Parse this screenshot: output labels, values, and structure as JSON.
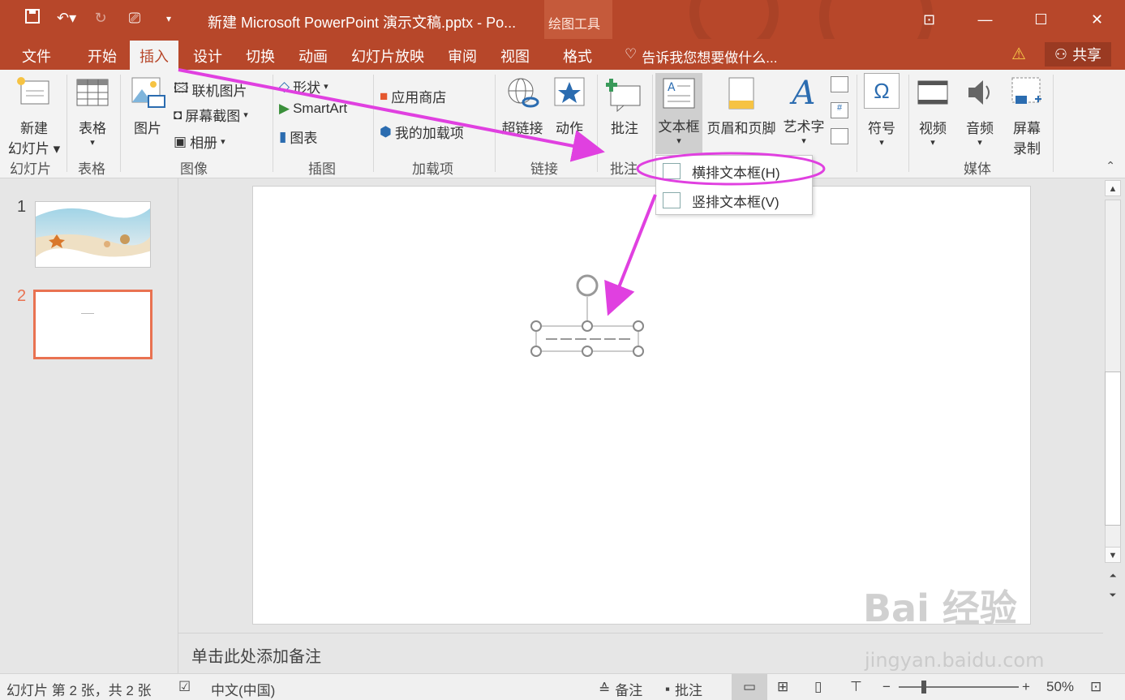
{
  "titlebar": {
    "title": "新建 Microsoft PowerPoint 演示文稿.pptx - Po...",
    "context_tab": "绘图工具",
    "accent": "#b7472a"
  },
  "tabs": [
    "文件",
    "开始",
    "插入",
    "设计",
    "切换",
    "动画",
    "幻灯片放映",
    "审阅",
    "视图",
    "格式"
  ],
  "active_tab": "插入",
  "tell_me": "告诉我您想要做什么...",
  "share": "共享",
  "ribbon": {
    "new_slide": [
      "新建",
      "幻灯片"
    ],
    "table": "表格",
    "picture": "图片",
    "online_picture": "联机图片",
    "screenshot": "屏幕截图",
    "album": "相册",
    "shapes": "形状",
    "smartart": "SmartArt",
    "chart": "图表",
    "store": "应用商店",
    "my_addins": "我的加载项",
    "hyperlink": "超链接",
    "action": "动作",
    "comment": "批注",
    "textbox": "文本框",
    "header_footer": "页眉和页脚",
    "wordart": "艺术字",
    "symbol": "符号",
    "video": "视频",
    "audio": "音频",
    "screen_record": [
      "屏幕",
      "录制"
    ],
    "groups": {
      "slides": "幻灯片",
      "tables": "表格",
      "images": "图像",
      "illustrations": "插图",
      "addins": "加载项",
      "links": "链接",
      "comments": "批注",
      "media": "媒体"
    }
  },
  "dropdown": {
    "horizontal": "横排文本框(H)",
    "vertical": "竖排文本框(V)"
  },
  "slides_pane": {
    "thumb1_num": "1",
    "thumb2_num": "2"
  },
  "notes_placeholder": "单击此处添加备注",
  "statusbar": {
    "slide_info": "幻灯片 第 2 张，共 2 张",
    "language": "中文(中国)",
    "notes": "备注",
    "comments": "批注",
    "zoom": "50%"
  },
  "watermark": {
    "main": "Bai 经验",
    "url": "jingyan.baidu.com"
  },
  "colors": {
    "highlight": "#e040e0",
    "selected_thumb": "#e97251"
  }
}
